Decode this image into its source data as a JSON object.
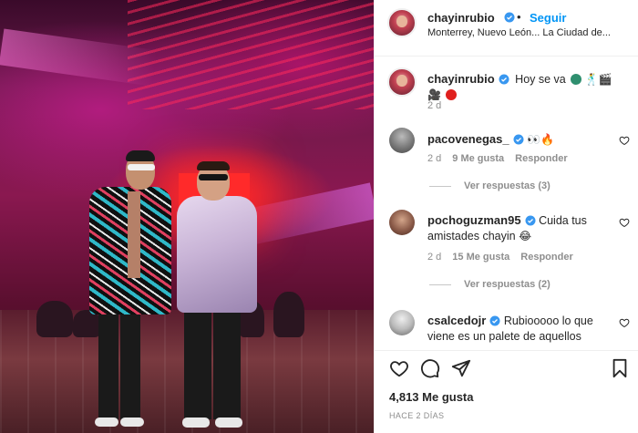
{
  "header": {
    "username": "chayinrubio",
    "follow_label": "Seguir",
    "separator": "•",
    "location": "Monterrey, Nuevo León... La Ciudad de..."
  },
  "caption": {
    "username": "chayinrubio",
    "text": "Hoy se va",
    "time": "2 d"
  },
  "comments": [
    {
      "username": "pacovenegas_",
      "text": "",
      "time": "2 d",
      "likes": "9 Me gusta",
      "reply_label": "Responder",
      "view_replies": "Ver respuestas (3)"
    },
    {
      "username": "pochoguzman95",
      "text": "Cuida tus amistades chayin",
      "time": "2 d",
      "likes": "15 Me gusta",
      "reply_label": "Responder",
      "view_replies": "Ver respuestas (2)"
    },
    {
      "username": "csalcedojr",
      "text": "Rubiooooo lo que viene es un palete de aquellos"
    }
  ],
  "footer": {
    "likes": "4,813 Me gusta",
    "time": "HACE 2 DÍAS"
  },
  "icons": {
    "verified": "verified-badge",
    "like": "heart-icon",
    "comment": "comment-icon",
    "share": "share-icon",
    "save": "bookmark-icon"
  },
  "colors": {
    "link": "#0095f6",
    "verified": "#3897f0",
    "muted": "#8e8e8e",
    "text": "#262626"
  }
}
